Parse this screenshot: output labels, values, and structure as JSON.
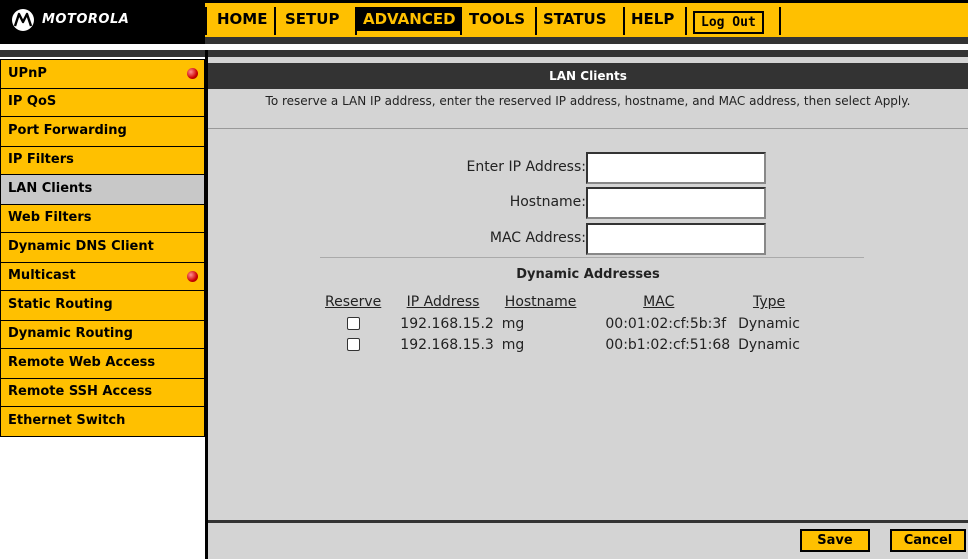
{
  "brand": {
    "name": "MOTOROLA",
    "logo_icon": "motorola-batwing-logo"
  },
  "topnav": {
    "tabs": [
      {
        "label": "HOME"
      },
      {
        "label": "SETUP"
      },
      {
        "label": "ADVANCED",
        "active": true
      },
      {
        "label": "TOOLS"
      },
      {
        "label": "STATUS"
      },
      {
        "label": "HELP"
      }
    ],
    "logout_label": "Log Out"
  },
  "sidebar": {
    "items": [
      {
        "label": "UPnP",
        "alert": true
      },
      {
        "label": "IP QoS"
      },
      {
        "label": "Port Forwarding"
      },
      {
        "label": "IP Filters"
      },
      {
        "label": "LAN Clients",
        "active": true
      },
      {
        "label": "Web Filters"
      },
      {
        "label": "Dynamic DNS Client"
      },
      {
        "label": "Multicast",
        "alert": true
      },
      {
        "label": "Static Routing"
      },
      {
        "label": "Dynamic Routing"
      },
      {
        "label": "Remote Web Access"
      },
      {
        "label": "Remote SSH Access"
      },
      {
        "label": "Ethernet Switch"
      }
    ],
    "alert_icon": "red-dot-icon"
  },
  "main": {
    "title": "LAN Clients",
    "instructions": "To reserve a LAN IP address, enter the reserved IP address, hostname, and MAC address, then select Apply.",
    "form": {
      "ip_label": "Enter IP Address:",
      "ip_value": "",
      "hostname_label": "Hostname:",
      "hostname_value": "",
      "mac_label": "MAC Address:",
      "mac_value": ""
    },
    "dynamic": {
      "heading": "Dynamic Addresses",
      "columns": [
        "Reserve",
        "IP Address",
        "Hostname",
        "MAC",
        "Type"
      ],
      "rows": [
        {
          "reserve": false,
          "ip": "192.168.15.2",
          "hostname": "mg",
          "mac": "00:01:02:cf:5b:3f",
          "type": "Dynamic"
        },
        {
          "reserve": false,
          "ip": "192.168.15.3",
          "hostname": "mg",
          "mac": "00:b1:02:cf:51:68",
          "type": "Dynamic"
        }
      ]
    },
    "buttons": {
      "save": "Save",
      "cancel": "Cancel"
    }
  },
  "colors": {
    "accent": "#ffc000",
    "dark": "#333333",
    "panel": "#d4d4d4",
    "active_item": "#c8c8c8"
  }
}
